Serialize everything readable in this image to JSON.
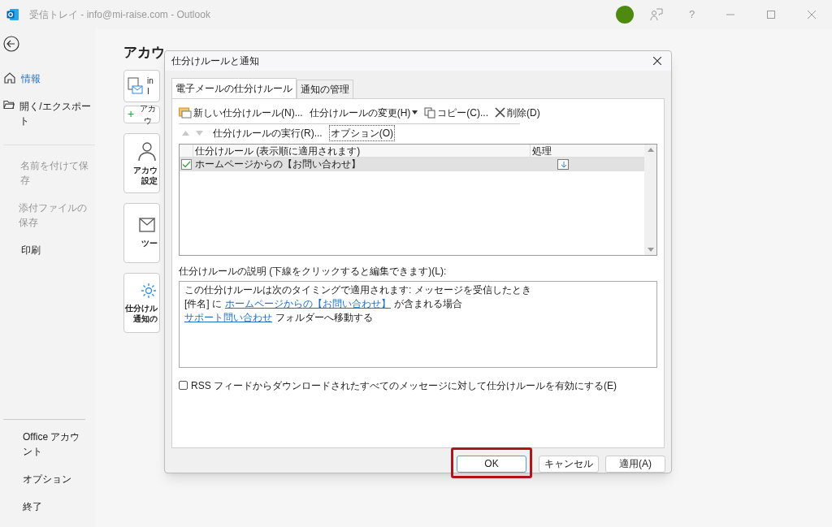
{
  "window": {
    "title": "受信トレイ - info@mi-raise.com - Outlook"
  },
  "titlebar_help": "?",
  "sidebar": {
    "items": [
      {
        "label": "情報",
        "selected": true,
        "disabled": false
      },
      {
        "label": "開く/エクスポート",
        "selected": false,
        "disabled": false
      },
      {
        "label": "名前を付けて保存",
        "selected": false,
        "disabled": true
      },
      {
        "label": "添付ファイルの保存",
        "selected": false,
        "disabled": true
      },
      {
        "label": "印刷",
        "selected": false,
        "disabled": false
      }
    ],
    "bottom_items": [
      "Office アカウント",
      "オプション",
      "終了"
    ]
  },
  "backstage": {
    "heading": "アカウ",
    "account_lines": [
      "in",
      "I"
    ],
    "add_icon": "+",
    "add_button": "アカウ",
    "tiles": [
      {
        "lines": [
          "アカウ",
          "設定"
        ]
      },
      {
        "lines": [
          "ツー"
        ]
      },
      {
        "lines": [
          "仕分けル",
          "通知の"
        ]
      }
    ]
  },
  "dialog": {
    "title": "仕分けルールと通知",
    "tabs": [
      {
        "label": "電子メールの仕分けルール",
        "selected": true
      },
      {
        "label": "通知の管理",
        "selected": false
      }
    ],
    "toolbar": [
      {
        "kind": "new",
        "label": "新しい仕分けルール(N)..."
      },
      {
        "kind": "dropdown",
        "label": "仕分けルールの変更(H)"
      },
      {
        "kind": "copy",
        "label": "コピー(C)..."
      },
      {
        "kind": "delete",
        "label": "削除(D)"
      }
    ],
    "toolbar2": {
      "run": "仕分けルールの実行(R)...",
      "options": "オプション(O)"
    },
    "table": {
      "columns": [
        "仕分けルール (表示順に適用されます)",
        "処理"
      ],
      "rows": [
        {
          "name": "ホームページからの【お問い合わせ】",
          "checked": true,
          "selected": true
        }
      ]
    },
    "description_label": "仕分けルールの説明 (下線をクリックすると編集できます)(L):",
    "description": [
      [
        {
          "text": "この仕分けルールは次のタイミングで適用されます: メッセージを受信したとき",
          "link": false
        }
      ],
      [
        {
          "text": "[件名] に",
          "link": false
        },
        {
          "text": "ホームページからの【お問い合わせ】",
          "link": true
        },
        {
          "text": "が含まれる場合",
          "link": false
        }
      ],
      [
        {
          "text": "サポート問い合わせ",
          "link": true
        },
        {
          "text": "フォルダーへ移動する",
          "link": false
        }
      ]
    ],
    "rss": {
      "label": "RSS フィードからダウンロードされたすべてのメッセージに対して仕分けルールを有効にする(E)",
      "checked": false
    },
    "buttons": [
      {
        "label": "OK",
        "highlighted": true
      },
      {
        "label": "キャンセル",
        "highlighted": false
      },
      {
        "label": "適用(A)",
        "highlighted": false
      }
    ]
  }
}
